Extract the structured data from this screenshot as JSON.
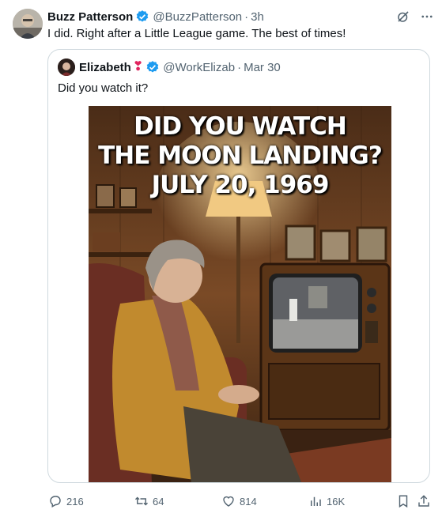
{
  "tweet": {
    "display_name": "Buzz Patterson",
    "handle": "@BuzzPatterson",
    "time": "3h",
    "text": "I did. Right after a Little League game. The best of times!",
    "verified_color": "#1d9bf0"
  },
  "quoted": {
    "display_name": "Elizabeth",
    "emoji": "❣",
    "handle": "@WorkElizab",
    "date": "Mar 30",
    "text": "Did you watch it?",
    "image_title_lines": [
      "DID YOU WATCH",
      "THE MOON LANDING?",
      "JULY 20, 1969"
    ]
  },
  "actions": {
    "replies": "216",
    "reposts": "64",
    "likes": "814",
    "views": "16K"
  },
  "icons": [
    "grok-icon",
    "more-icon",
    "verified-badge-icon",
    "reply-icon",
    "repost-icon",
    "like-icon",
    "views-icon",
    "bookmark-icon",
    "share-icon"
  ]
}
